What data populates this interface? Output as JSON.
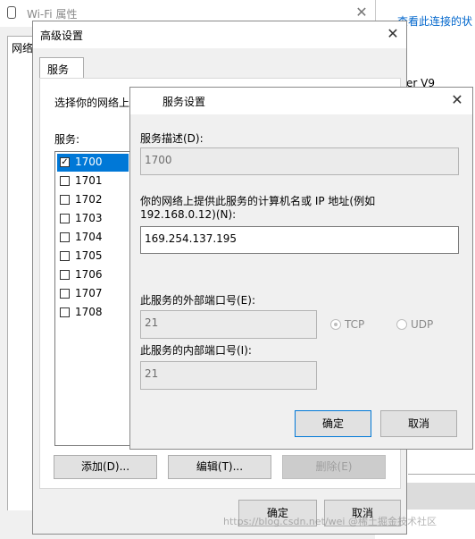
{
  "wifi_window": {
    "title": "Wi-Fi 属性",
    "tab_network": "网络",
    "right_link": "查看此连接的状",
    "partial_text": "er V9"
  },
  "advanced_dialog": {
    "title": "高级设置",
    "tab_services": "服务",
    "instruction": "选择你的网络上",
    "services_label": "服务:",
    "services": [
      {
        "label": "1700",
        "checked": true,
        "selected": true
      },
      {
        "label": "1701",
        "checked": false,
        "selected": false
      },
      {
        "label": "1702",
        "checked": false,
        "selected": false
      },
      {
        "label": "1703",
        "checked": false,
        "selected": false
      },
      {
        "label": "1704",
        "checked": false,
        "selected": false
      },
      {
        "label": "1705",
        "checked": false,
        "selected": false
      },
      {
        "label": "1706",
        "checked": false,
        "selected": false
      },
      {
        "label": "1707",
        "checked": false,
        "selected": false
      },
      {
        "label": "1708",
        "checked": false,
        "selected": false
      }
    ],
    "add_label": "添加(D)...",
    "edit_label": "编辑(T)...",
    "delete_label": "删除(E)",
    "ok_label": "确定",
    "cancel_label": "取消"
  },
  "service_dialog": {
    "title": "服务设置",
    "desc_label": "服务描述(D):",
    "desc_value": "1700",
    "host_label_line1": "你的网络上提供此服务的计算机名或 IP 地址(例如",
    "host_label_line2": "192.168.0.12)(N):",
    "host_value": "169.254.137.195",
    "ext_port_label": "此服务的外部端口号(E):",
    "ext_port_value": "21",
    "tcp_label": "TCP",
    "udp_label": "UDP",
    "int_port_label": "此服务的内部端口号(I):",
    "int_port_value": "21",
    "ok_label": "确定",
    "cancel_label": "取消"
  },
  "watermark": "https://blog.csdn.net/wei @稀土掘金技术社区"
}
